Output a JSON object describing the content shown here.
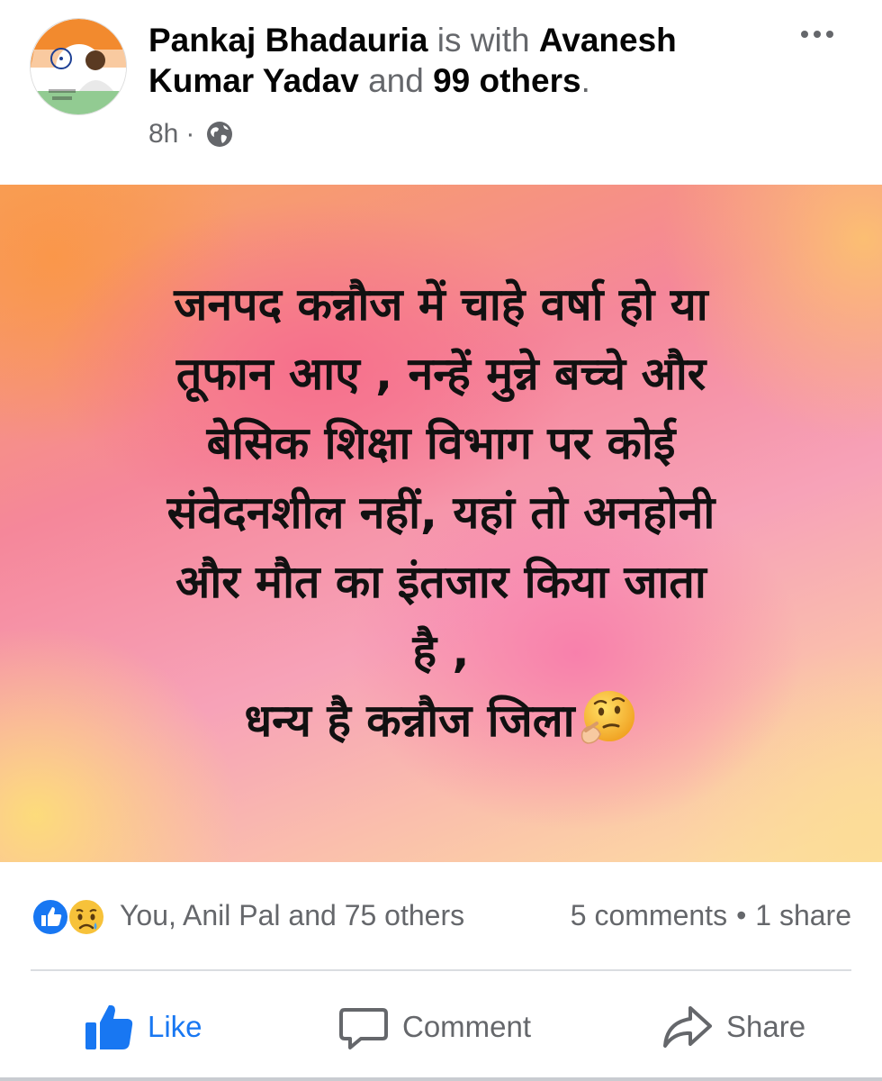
{
  "header": {
    "author": "Pankaj Bhadauria",
    "with_text": "is with",
    "tagged": "Avanesh Kumar Yadav",
    "and_text": "and",
    "others": "99 others",
    "period": ".",
    "time": "8h",
    "dot": "·",
    "privacy_icon": "globe-icon",
    "more_icon": "more-dots-icon"
  },
  "post": {
    "lines": [
      "जनपद कन्नौज में चाहे वर्षा हो या",
      "तूफान आए , नन्हें मुन्ने बच्चे और",
      "बेसिक शिक्षा विभाग पर कोई",
      "संवेदनशील नहीं, यहां तो अनहोनी",
      "और मौत का इंतजार किया जाता",
      "है ,",
      "धन्य है कन्नौज जिला"
    ],
    "emoji": "thinking-face-emoji"
  },
  "stats": {
    "reactions_text": "You, Anil Pal and 75 others",
    "comments": "5 comments",
    "bullet": "•",
    "shares": "1 share",
    "reaction_icons": [
      "like-reaction-icon",
      "sad-reaction-icon"
    ]
  },
  "actions": {
    "like": "Like",
    "comment": "Comment",
    "share": "Share"
  },
  "colors": {
    "facebook_blue": "#1877f2",
    "secondary_text": "#65676b",
    "primary_text": "#050505"
  }
}
